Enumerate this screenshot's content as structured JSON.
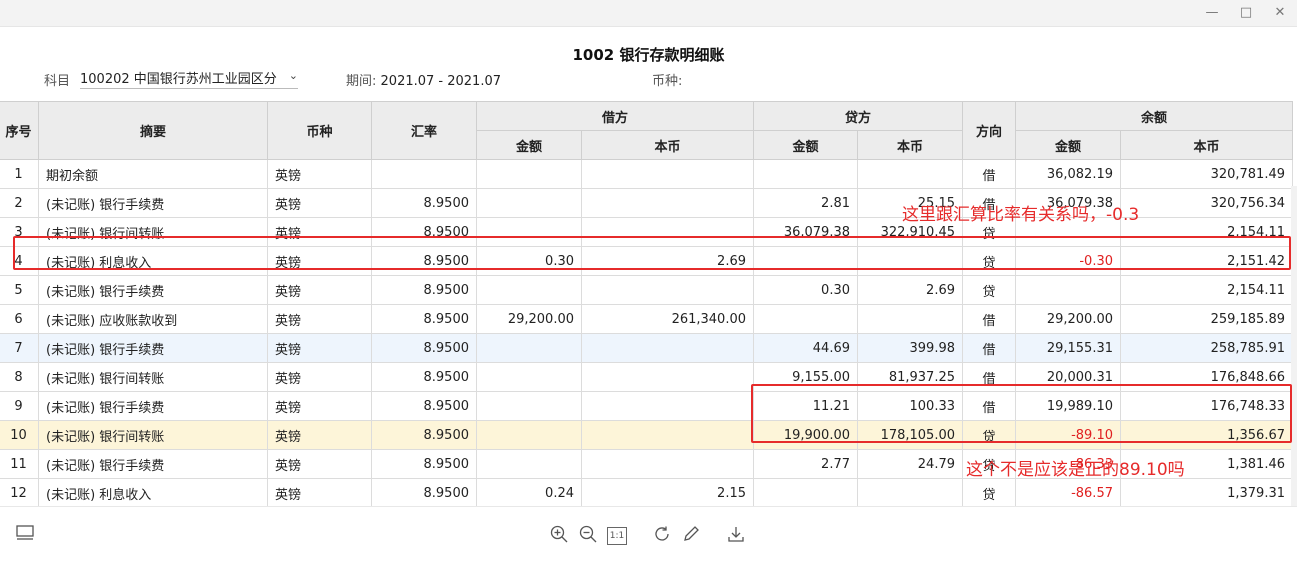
{
  "window": {
    "minimize": "—",
    "maximize": "□",
    "close": "✕"
  },
  "report": {
    "title": "1002 银行存款明细账",
    "subject_label": "科目",
    "subject_value": "100202 中国银行苏州工业园区分",
    "period_label": "期间:",
    "period_value": "2021.07 - 2021.07",
    "currency_label": "币种:",
    "currency_value": ""
  },
  "columns": {
    "seq": "序号",
    "summary": "摘要",
    "currency": "币种",
    "rate": "汇率",
    "debit": "借方",
    "credit": "贷方",
    "direction": "方向",
    "balance": "余额",
    "amount": "金额",
    "local": "本币"
  },
  "rows": [
    {
      "seq": "1",
      "summary": "期初余额",
      "cur": "英镑",
      "rate": "",
      "d_amt": "",
      "d_loc": "",
      "c_amt": "",
      "c_loc": "",
      "dir": "借",
      "b_amt": "36,082.19",
      "b_loc": "320,781.49"
    },
    {
      "seq": "2",
      "summary": "(未记账) 银行手续费",
      "cur": "英镑",
      "rate": "8.9500",
      "d_amt": "",
      "d_loc": "",
      "c_amt": "2.81",
      "c_loc": "25.15",
      "dir": "借",
      "b_amt": "36,079.38",
      "b_loc": "320,756.34"
    },
    {
      "seq": "3",
      "summary": "(未记账) 银行间转账",
      "cur": "英镑",
      "rate": "8.9500",
      "d_amt": "",
      "d_loc": "",
      "c_amt": "36,079.38",
      "c_loc": "322,910.45",
      "dir": "贷",
      "b_amt": "",
      "b_loc": "2,154.11"
    },
    {
      "seq": "4",
      "summary": "(未记账) 利息收入",
      "cur": "英镑",
      "rate": "8.9500",
      "d_amt": "0.30",
      "d_loc": "2.69",
      "c_amt": "",
      "c_loc": "",
      "dir": "贷",
      "b_amt": "-0.30",
      "b_loc": "2,151.42"
    },
    {
      "seq": "5",
      "summary": "(未记账) 银行手续费",
      "cur": "英镑",
      "rate": "8.9500",
      "d_amt": "",
      "d_loc": "",
      "c_amt": "0.30",
      "c_loc": "2.69",
      "dir": "贷",
      "b_amt": "",
      "b_loc": "2,154.11"
    },
    {
      "seq": "6",
      "summary": "(未记账) 应收账款收到",
      "cur": "英镑",
      "rate": "8.9500",
      "d_amt": "29,200.00",
      "d_loc": "261,340.00",
      "c_amt": "",
      "c_loc": "",
      "dir": "借",
      "b_amt": "29,200.00",
      "b_loc": "259,185.89"
    },
    {
      "seq": "7",
      "summary": "(未记账) 银行手续费",
      "cur": "英镑",
      "rate": "8.9500",
      "d_amt": "",
      "d_loc": "",
      "c_amt": "44.69",
      "c_loc": "399.98",
      "dir": "借",
      "b_amt": "29,155.31",
      "b_loc": "258,785.91"
    },
    {
      "seq": "8",
      "summary": "(未记账) 银行间转账",
      "cur": "英镑",
      "rate": "8.9500",
      "d_amt": "",
      "d_loc": "",
      "c_amt": "9,155.00",
      "c_loc": "81,937.25",
      "dir": "借",
      "b_amt": "20,000.31",
      "b_loc": "176,848.66"
    },
    {
      "seq": "9",
      "summary": "(未记账) 银行手续费",
      "cur": "英镑",
      "rate": "8.9500",
      "d_amt": "",
      "d_loc": "",
      "c_amt": "11.21",
      "c_loc": "100.33",
      "dir": "借",
      "b_amt": "19,989.10",
      "b_loc": "176,748.33"
    },
    {
      "seq": "10",
      "summary": "(未记账) 银行间转账",
      "cur": "英镑",
      "rate": "8.9500",
      "d_amt": "",
      "d_loc": "",
      "c_amt": "19,900.00",
      "c_loc": "178,105.00",
      "dir": "贷",
      "b_amt": "-89.10",
      "b_loc": "1,356.67"
    },
    {
      "seq": "11",
      "summary": "(未记账) 银行手续费",
      "cur": "英镑",
      "rate": "8.9500",
      "d_amt": "",
      "d_loc": "",
      "c_amt": "2.77",
      "c_loc": "24.79",
      "dir": "贷",
      "b_amt": "-86.33",
      "b_loc": "1,381.46"
    },
    {
      "seq": "12",
      "summary": "(未记账) 利息收入",
      "cur": "英镑",
      "rate": "8.9500",
      "d_amt": "0.24",
      "d_loc": "2.15",
      "c_amt": "",
      "c_loc": "",
      "dir": "贷",
      "b_amt": "-86.57",
      "b_loc": "1,379.31"
    }
  ],
  "annotations": {
    "note1": "这里跟汇算比率有关系吗，-0.3",
    "note2": "这个不是应该是正的89.10吗"
  },
  "footer": {
    "layout_icon": "panel-layout-icon",
    "zoom_in_icon": "zoom-in-icon",
    "zoom_out_icon": "zoom-out-icon",
    "actual_size": "1:1",
    "refresh_icon": "refresh-icon",
    "edit_icon": "pencil-icon",
    "download_icon": "download-icon"
  }
}
